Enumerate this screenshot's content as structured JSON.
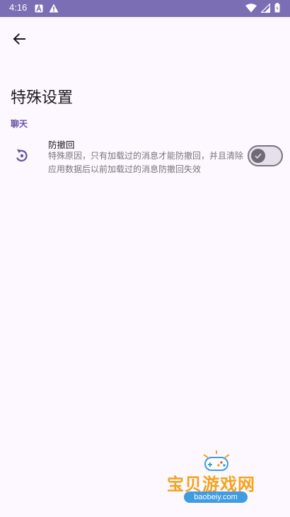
{
  "status_bar": {
    "time": "4:16",
    "left_icons": [
      "a-icon",
      "warning-icon"
    ],
    "right_icons": [
      "wifi-icon",
      "cellular-icon",
      "battery-icon"
    ]
  },
  "toolbar": {
    "back_icon": "arrow-back-icon"
  },
  "page": {
    "title": "特殊设置"
  },
  "section": {
    "header": "聊天"
  },
  "settings": [
    {
      "icon": "undo-rotate-icon",
      "title": "防撤回",
      "description": "特殊原因，只有加载过的消息才能防撤回，并且清除应用数据后以前加载过的消息防撤回失效",
      "enabled": false
    }
  ],
  "watermark": {
    "text": "宝贝游戏网",
    "url": "baobeiy.com"
  },
  "colors": {
    "status_bar": "#7B6EB5",
    "background": "#FDF7FF",
    "accent": "#6750A4",
    "watermark_orange": "#F4A21E",
    "watermark_blue": "#3F9CE0"
  }
}
